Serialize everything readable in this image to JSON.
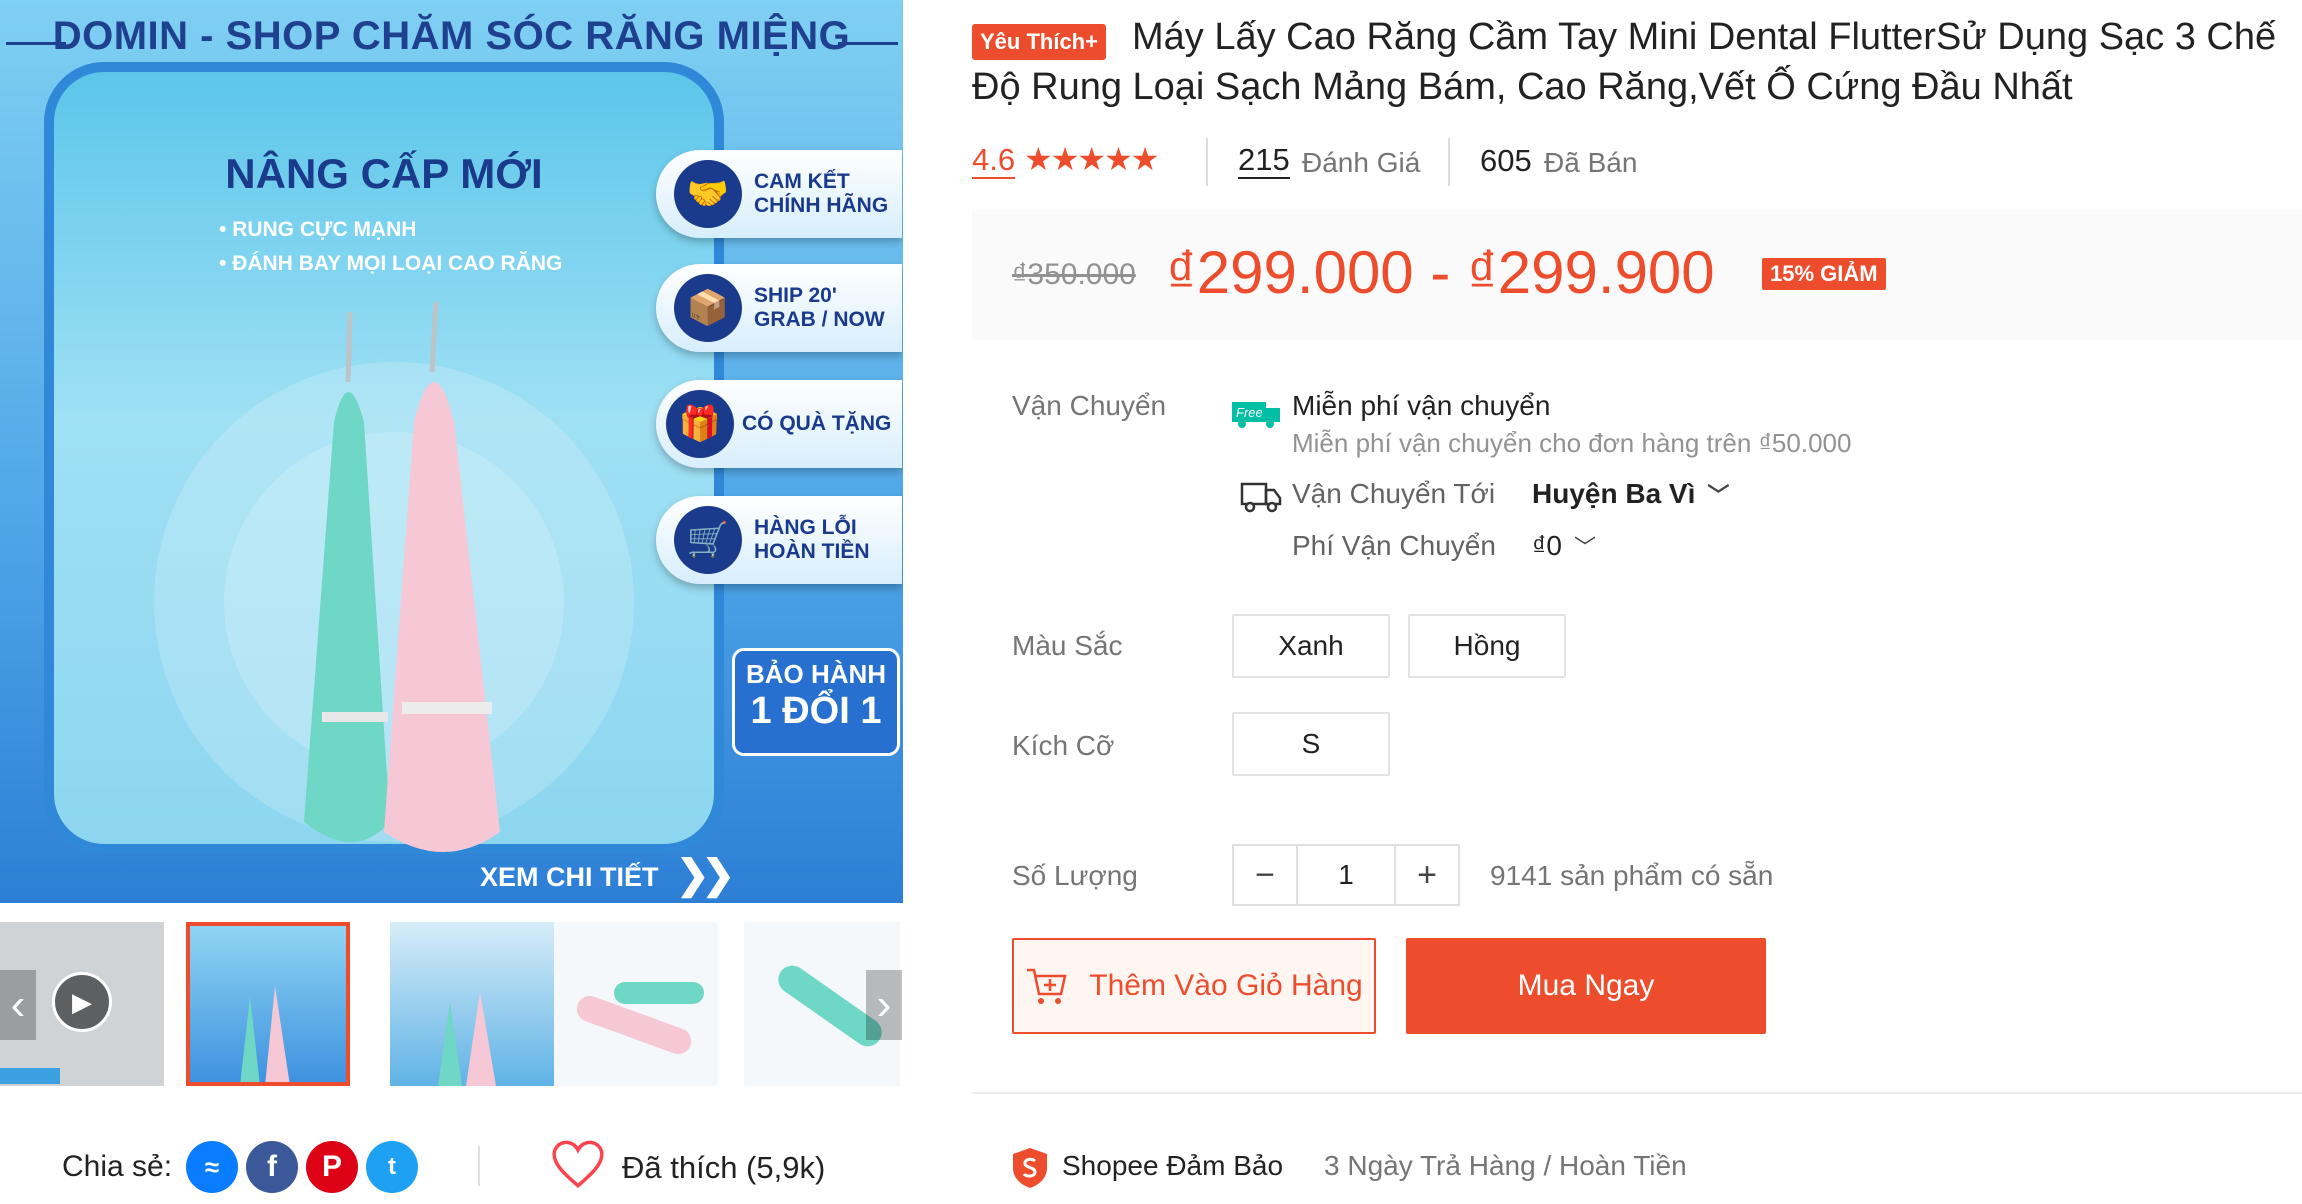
{
  "gallery": {
    "banner_title": "DOMIN - SHOP CHĂM SÓC RĂNG MIỆNG",
    "upgrade": "NÂNG CẤP MỚI",
    "bullets": [
      "RUNG CỰC MẠNH",
      "ĐÁNH BAY MỌI LOẠI CAO RĂNG"
    ],
    "features": [
      {
        "icon": "handshake-icon",
        "label": "CAM KẾT\nCHÍNH HÃNG"
      },
      {
        "icon": "delivery-icon",
        "label": "SHIP 20'\nGRAB / NOW"
      },
      {
        "icon": "gift-icon",
        "label": "CÓ QUÀ TẶNG"
      },
      {
        "icon": "return-cart-icon",
        "label": "HÀNG LỖI\nHOÀN TIỀN"
      }
    ],
    "warranty_line1": "BẢO HÀNH",
    "warranty_line2": "1 ĐỔI 1",
    "more_link": "XEM CHI TIẾT"
  },
  "share": {
    "label": "Chia sẻ:",
    "networks": [
      "messenger",
      "facebook",
      "pinterest",
      "twitter"
    ],
    "liked": "Đã thích (5,9k)"
  },
  "product": {
    "badge": "Yêu Thích+",
    "title": "Máy Lấy Cao Răng Cầm Tay Mini Dental FlutterSử Dụng Sạc 3 Chế Độ Rung Loại Sạch Mảng Bám, Cao Răng,Vết Ố Cứng Đầu Nhất",
    "rating": "4.6",
    "review_count": "215",
    "review_label": "Đánh Giá",
    "sold_count": "605",
    "sold_label": "Đã Bán",
    "old_price": "₫350.000",
    "price": "₫299.000 - ₫299.900",
    "discount": "15% GIẢM"
  },
  "shipping": {
    "label": "Vận Chuyển",
    "free_badge": "Free",
    "free_title": "Miễn phí vận chuyển",
    "free_sub": "Miễn phí vận chuyển cho đơn hàng trên ₫50.000",
    "to_label": "Vận Chuyển Tới",
    "to_value": "Huyện Ba Vì",
    "fee_label": "Phí Vận Chuyển",
    "fee_value": "₫0"
  },
  "color": {
    "label": "Màu Sắc",
    "options": [
      "Xanh",
      "Hồng"
    ]
  },
  "size": {
    "label": "Kích Cỡ",
    "options": [
      "S"
    ]
  },
  "quantity": {
    "label": "Số Lượng",
    "value": "1",
    "stock": "9141 sản phẩm có sẵn"
  },
  "actions": {
    "add_to_cart": "Thêm Vào Giỏ Hàng",
    "buy_now": "Mua Ngay"
  },
  "guarantee": {
    "label": "Shopee Đảm Bảo",
    "detail": "3 Ngày Trả Hàng / Hoàn Tiền"
  },
  "colors": {
    "accent": "#ee4d2d",
    "brand_blue": "#1a3a8c"
  }
}
